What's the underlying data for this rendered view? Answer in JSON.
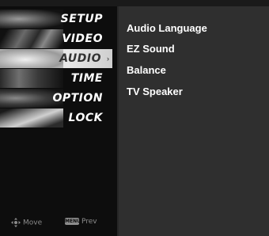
{
  "menu": {
    "items": [
      {
        "label": "SETUP",
        "icon": "setup-icon"
      },
      {
        "label": "VIDEO",
        "icon": "video-icon"
      },
      {
        "label": "AUDIO",
        "icon": "audio-icon",
        "selected": true
      },
      {
        "label": "TIME",
        "icon": "time-icon"
      },
      {
        "label": "OPTION",
        "icon": "option-icon"
      },
      {
        "label": "LOCK",
        "icon": "lock-icon"
      }
    ],
    "selected_arrow": "›"
  },
  "submenu": {
    "items": [
      {
        "label": "Audio Language"
      },
      {
        "label": "EZ Sound"
      },
      {
        "label": "Balance"
      },
      {
        "label": "TV Speaker"
      }
    ]
  },
  "footer": {
    "move_label": "Move",
    "prev_label": "Prev",
    "menu_key_label": "MENU"
  },
  "colors": {
    "menu_bg": "#0d0d0d",
    "panel_bg": "#2f2f2f",
    "selected_bg": "#dcdcdc",
    "text": "#ffffff"
  }
}
